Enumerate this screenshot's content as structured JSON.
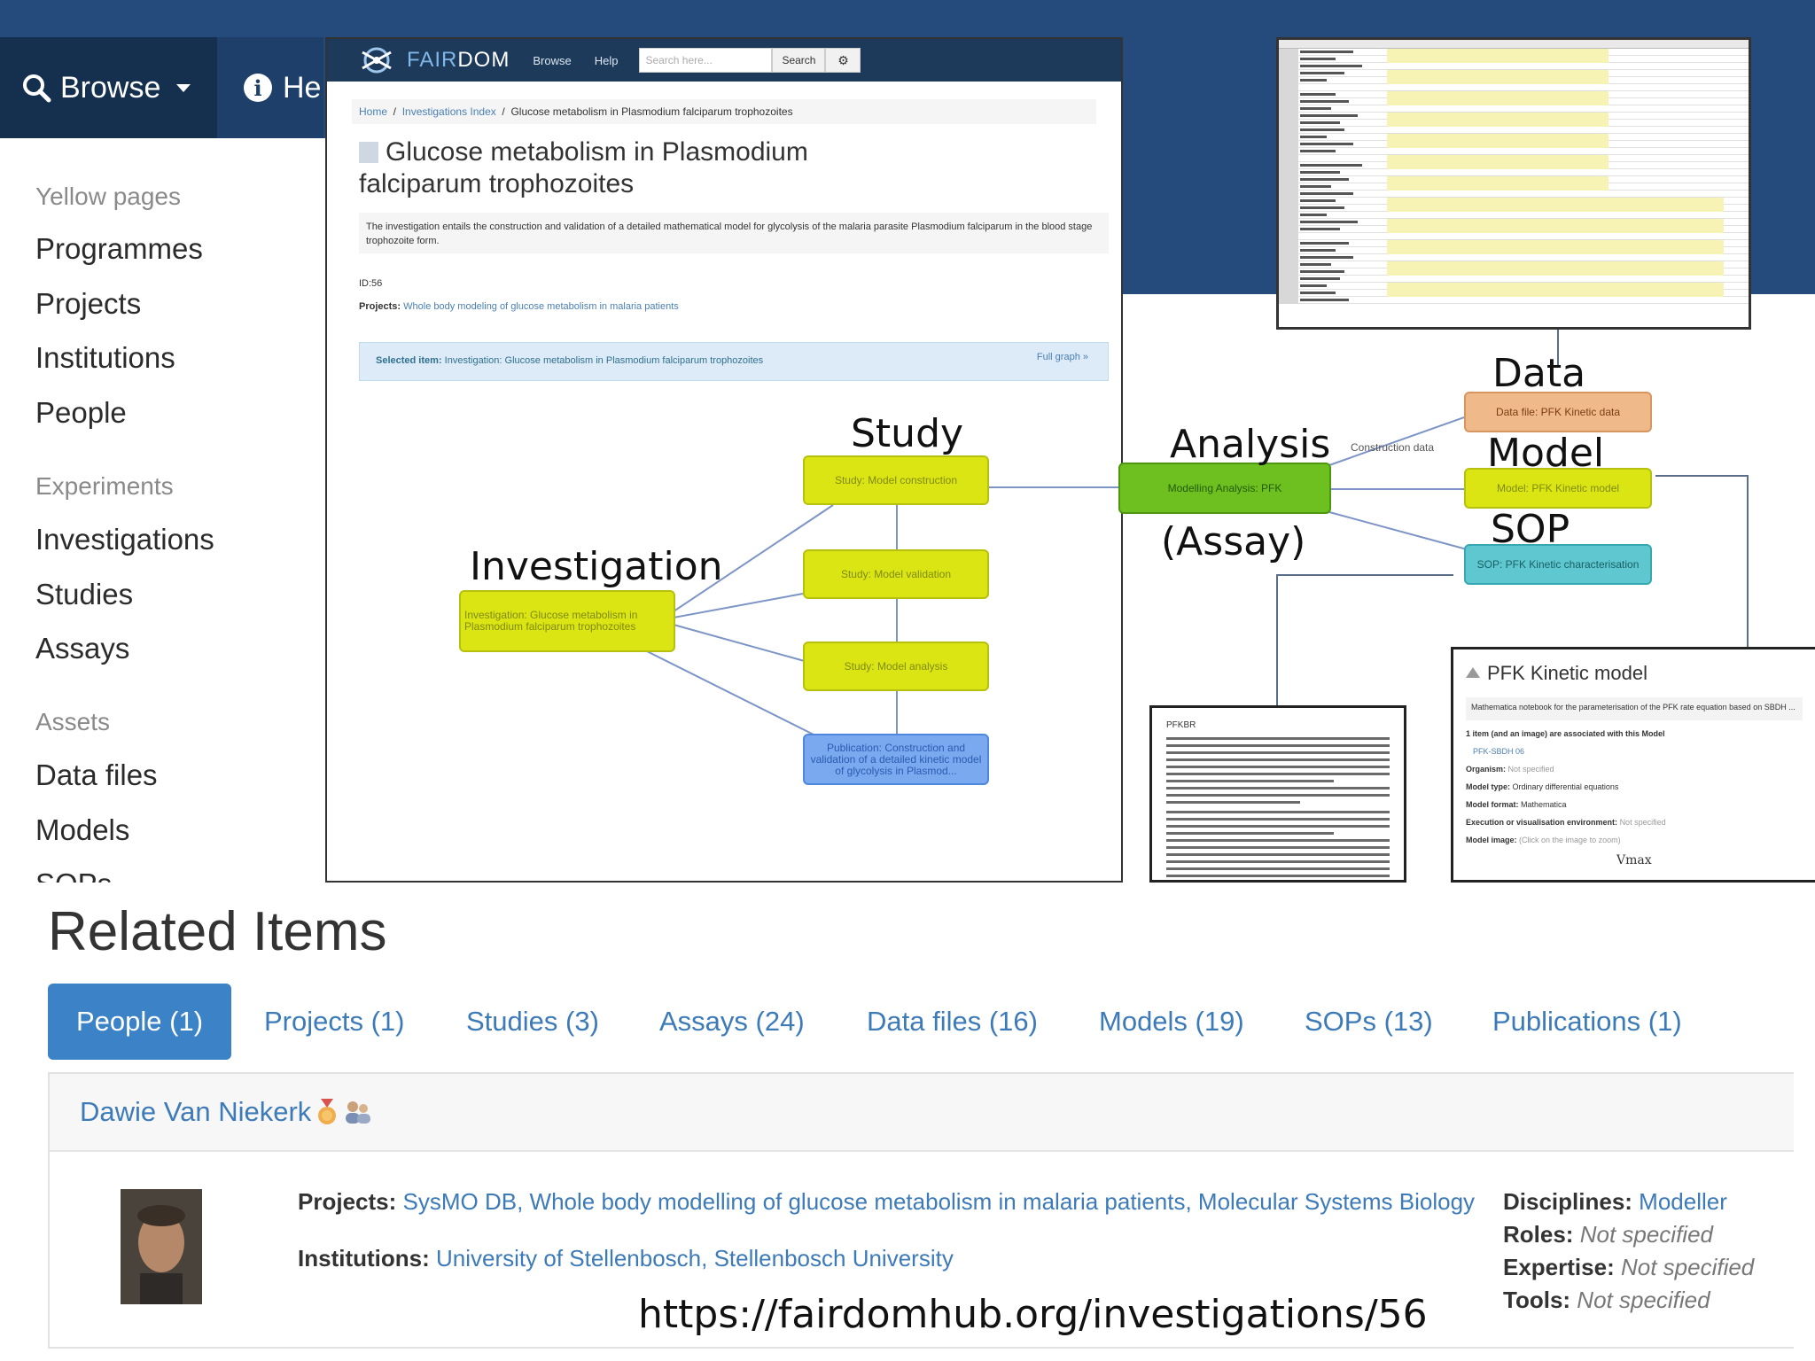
{
  "nav": {
    "browse_label": "Browse",
    "help_label": "He"
  },
  "sidebar": {
    "yellow_pages_heading": "Yellow pages",
    "yellow_pages": [
      "Programmes",
      "Projects",
      "Institutions",
      "People"
    ],
    "experiments_heading": "Experiments",
    "experiments": [
      "Investigations",
      "Studies",
      "Assays"
    ],
    "assets_heading": "Assets",
    "assets": [
      "Data files",
      "Models",
      "SOPs"
    ]
  },
  "fairdom": {
    "logo_prefix": "FAIR",
    "logo_suffix": "DOM",
    "nav_browse": "Browse",
    "nav_help": "Help",
    "search_placeholder": "Search here...",
    "search_button": "Search",
    "breadcrumb": {
      "home": "Home",
      "index": "Investigations Index",
      "current": "Glucose metabolism in Plasmodium falciparum trophozoites"
    },
    "title": "Glucose metabolism in Plasmodium falciparum trophozoites",
    "description": "The investigation entails the construction and validation of a detailed mathematical model for glycolysis of the malaria parasite Plasmodium falciparum in the blood stage trophozoite form.",
    "id_text": "ID:56",
    "projects_label": "Projects:",
    "projects_value": "Whole body modeling of glucose metabolism in malaria patients",
    "selected_label": "Selected item:",
    "selected_value": "Investigation: Glucose metabolism in Plasmodium falciparum trophozoites",
    "full_graph": "Full graph »"
  },
  "graph": {
    "investigation_node": "Investigation: Glucose metabolism in Plasmodium falciparum trophozoites",
    "study_construction": "Study: Model construction",
    "study_validation": "Study: Model validation",
    "study_analysis": "Study: Model analysis",
    "publication": "Publication: Construction and validation of a detailed kinetic model of glycolysis in Plasmod...",
    "assay_node": "Modelling Analysis: PFK",
    "data_node": "Data file: PFK Kinetic data",
    "model_node": "Model: PFK Kinetic model",
    "sop_node": "SOP: PFK Kinetic characterisation",
    "edge_label": "Construction data"
  },
  "annotations": {
    "investigation": "Investigation",
    "study": "Study",
    "analysis": "Analysis",
    "assay": "(Assay)",
    "data": "Data",
    "model": "Model",
    "sop": "SOP"
  },
  "model_card": {
    "title": "PFK Kinetic model",
    "subtitle": "Mathematica notebook for the parameterisation of the PFK rate equation based on SBDH ...",
    "assoc": "1 item (and an image) are associated with this Model",
    "file": "PFK-SBDH 06",
    "organism_label": "Organism:",
    "organism_value": "Not specified",
    "model_type_label": "Model type:",
    "model_type_value": "Ordinary differential equations",
    "model_format_label": "Model format:",
    "model_format_value": "Mathematica",
    "execution_label": "Execution or visualisation environment:",
    "execution_value": "Not specified",
    "model_image_label": "Model image:",
    "model_image_value": "(Click on the image to zoom)",
    "formula": "Vmax"
  },
  "paper": {
    "heading": "PFKBR"
  },
  "related": {
    "title": "Related Items",
    "tabs": [
      "People (1)",
      "Projects (1)",
      "Studies (3)",
      "Assays (24)",
      "Data files (16)",
      "Models (19)",
      "SOPs (13)",
      "Publications (1)"
    ],
    "person_name": "Dawie Van Niekerk",
    "projects_label": "Projects:",
    "projects": [
      "SysMO DB",
      "Whole body modelling of glucose metabolism in malaria patients",
      "Molecular Systems Biology"
    ],
    "institutions_label": "Institutions:",
    "institutions": [
      "University of Stellenbosch",
      "Stellenbosch University"
    ],
    "disciplines_label": "Disciplines:",
    "disciplines_value": "Modeller",
    "roles_label": "Roles:",
    "roles_value": "Not specified",
    "expertise_label": "Expertise:",
    "expertise_value": "Not specified",
    "tools_label": "Tools:",
    "tools_value": "Not specified",
    "url": "https://fairdomhub.org/investigations/56"
  }
}
